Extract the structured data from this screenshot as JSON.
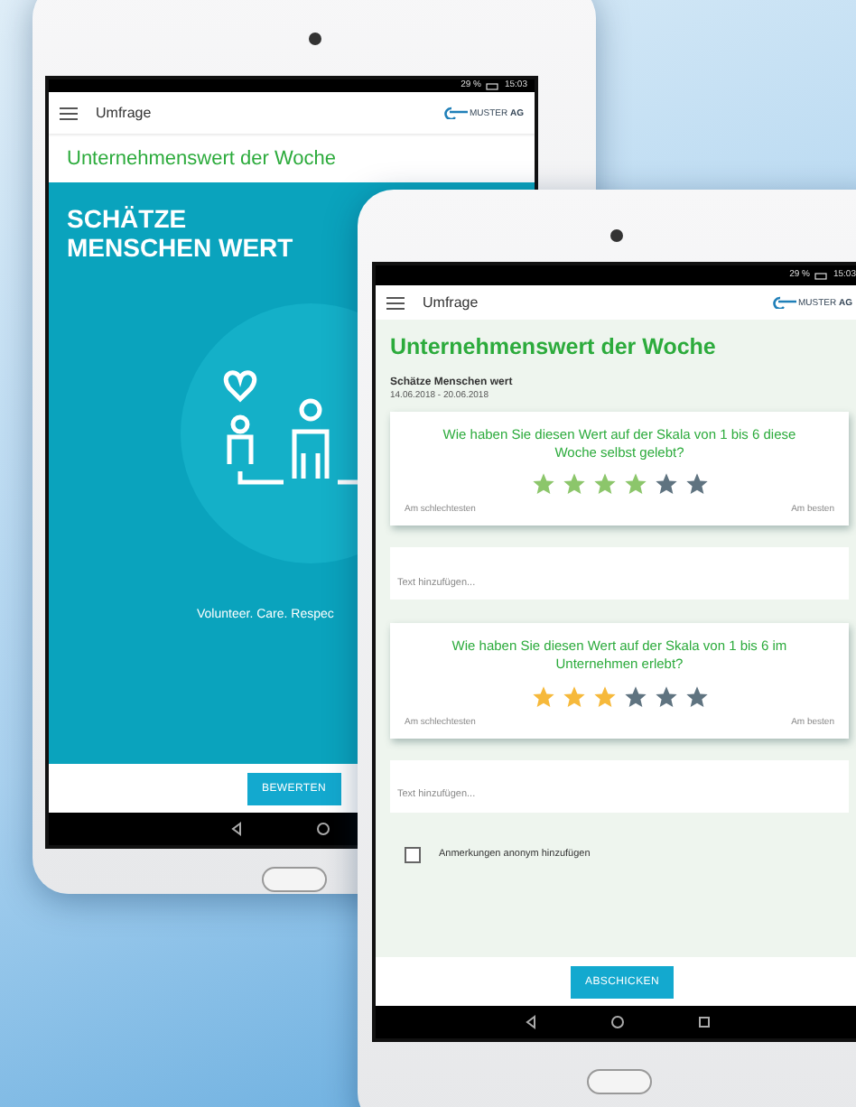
{
  "back_tablet": {
    "status": {
      "battery": "29 %",
      "time": "15:03"
    },
    "app_bar": {
      "title": "Umfrage",
      "logo": "MUSTER **AG**"
    },
    "heading": "Unternehmenswert der Woche",
    "hero": {
      "title_lines": [
        "SCHÄTZE",
        "MENSCHEN WERT"
      ],
      "tagline": "Volunteer. Care. Respec"
    },
    "button": "BEWERTEN"
  },
  "front_tablet": {
    "status": {
      "battery": "29 %",
      "time": "15:03"
    },
    "app_bar": {
      "title": "Umfrage",
      "logo": "MUSTER **AG**"
    },
    "heading": "Unternehmenswert der Woche",
    "subtitle": "Schätze Menschen wert",
    "date_range": "14.06.2018 - 20.06.2018",
    "questions": [
      {
        "text": "Wie haben Sie diesen Wert auf der Skala von 1 bis 6 diese Woche selbst gelebt?",
        "stars": 4,
        "color": "#8cc66b",
        "low_label": "Am schlechtesten",
        "high_label": "Am besten",
        "note": {
          "placeholder": "Text hinzufügen..."
        }
      },
      {
        "text": "Wie haben Sie diesen Wert auf der Skala von 1 bis 6 im Unternehmen erlebt?",
        "stars": 3,
        "color": "#f6b93b",
        "low_label": "Am schlechtesten",
        "high_label": "Am besten",
        "note": {
          "placeholder": "Text hinzufügen..."
        }
      }
    ],
    "anonymous": {
      "label": "Anmerkungen anonym hinzufügen",
      "checked": false
    },
    "submit": "ABSCHICKEN"
  }
}
